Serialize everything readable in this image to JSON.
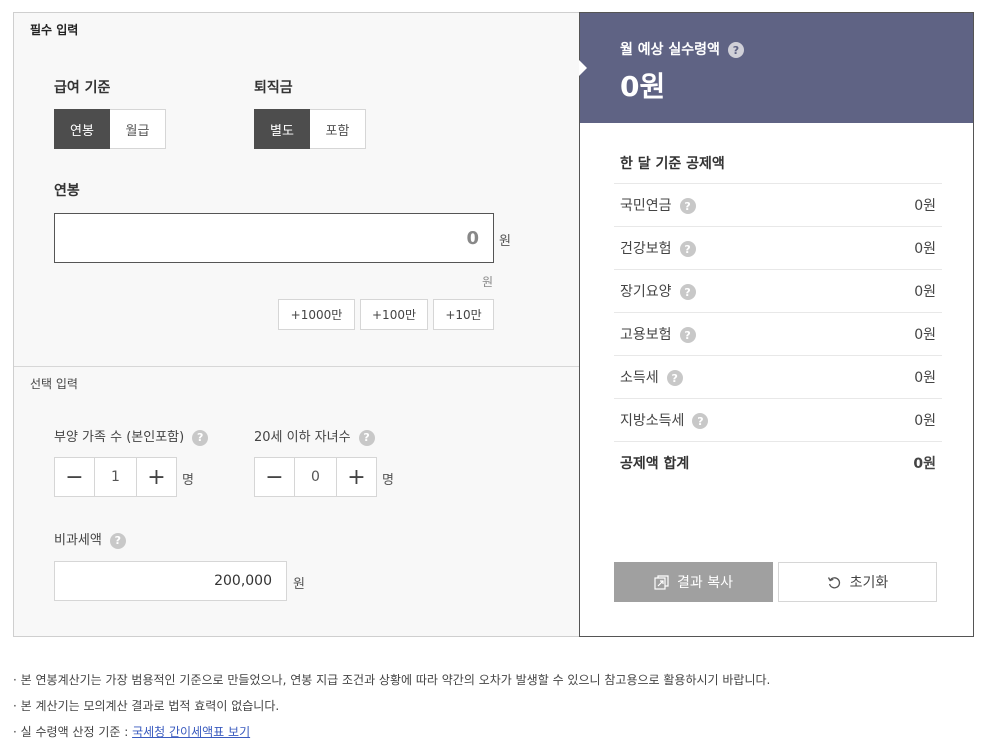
{
  "required": {
    "section_title": "필수 입력",
    "pay_basis": {
      "label": "급여 기준",
      "options": [
        "연봉",
        "월급"
      ],
      "selected": "연봉"
    },
    "severance": {
      "label": "퇴직금",
      "options": [
        "별도",
        "포함"
      ],
      "selected": "별도"
    },
    "salary": {
      "label": "연봉",
      "value": "0",
      "unit": "원",
      "converted_unit": "원"
    },
    "quick_add": [
      "+1000만",
      "+100만",
      "+10만"
    ]
  },
  "optional": {
    "section_title": "선택 입력",
    "dependents": {
      "label": "부양 가족 수 (본인포함)",
      "value": "1",
      "unit": "명"
    },
    "children": {
      "label": "20세 이하 자녀수",
      "value": "0",
      "unit": "명"
    },
    "tax_free": {
      "label": "비과세액",
      "value": "200,000",
      "unit": "원"
    },
    "minus": "−",
    "plus": "+"
  },
  "summary": {
    "title": "월 예상 실수령액",
    "value": "0원"
  },
  "deductions": {
    "title": "한 달 기준 공제액",
    "items": [
      {
        "label": "국민연금",
        "value": "0원"
      },
      {
        "label": "건강보험",
        "value": "0원"
      },
      {
        "label": "장기요양",
        "value": "0원"
      },
      {
        "label": "고용보험",
        "value": "0원"
      },
      {
        "label": "소득세",
        "value": "0원"
      },
      {
        "label": "지방소득세",
        "value": "0원"
      }
    ],
    "total": {
      "label": "공제액 합계",
      "value": "0원"
    }
  },
  "buttons": {
    "copy": "결과 복사",
    "reset": "초기화"
  },
  "help_glyph": "?",
  "notes": [
    "· 본 연봉계산기는 가장 범용적인 기준으로 만들었으나, 연봉 지급 조건과 상황에 따라 약간의 오차가 발생할 수 있으니 참고용으로 활용하시기 바랍니다.",
    "· 본 계산기는 모의계산 결과로 법적 효력이 없습니다."
  ],
  "note_basis": {
    "prefix": "· 실 수령액 산정 기준 : ",
    "link": "국세청 간이세액표 보기"
  }
}
